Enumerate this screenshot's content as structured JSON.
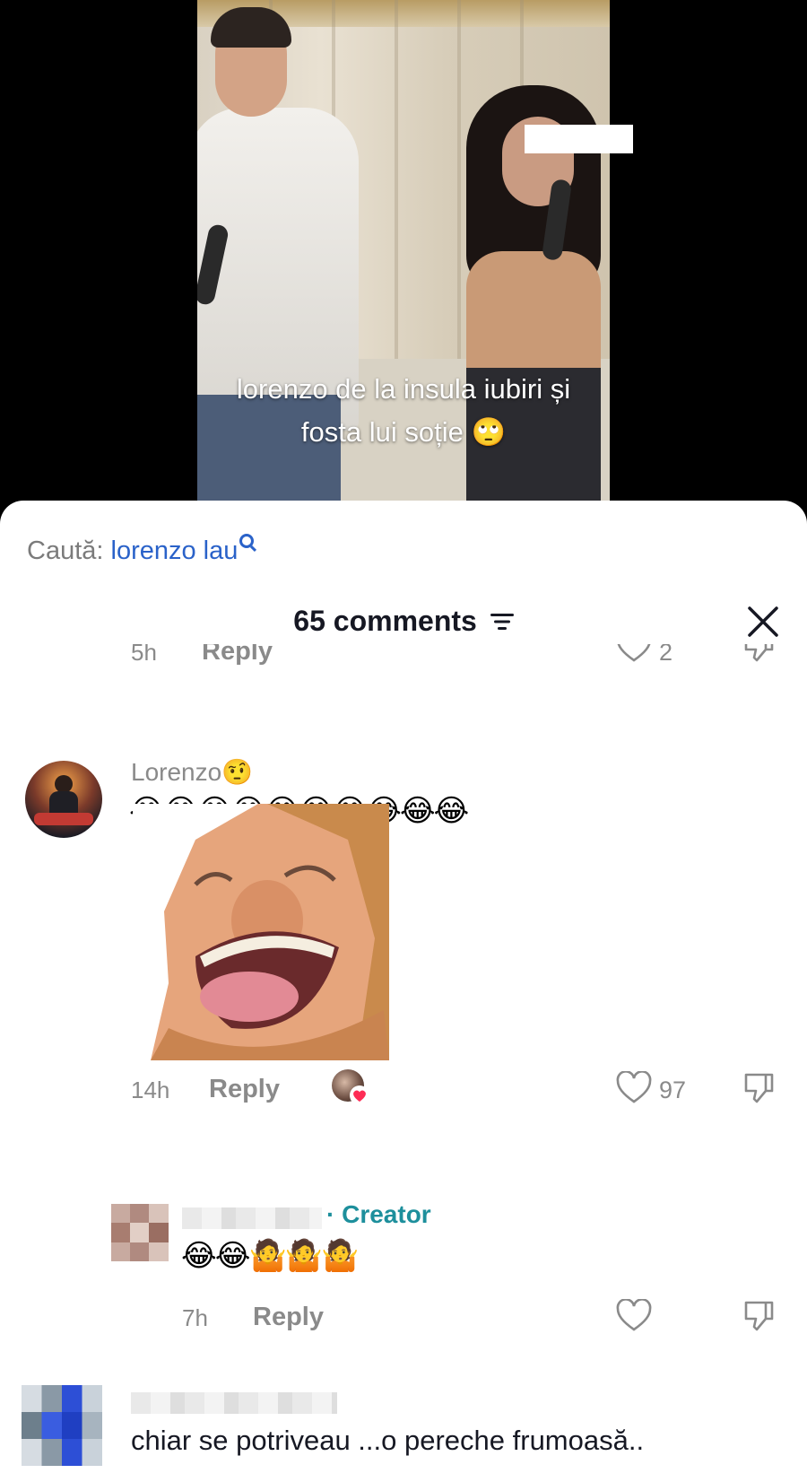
{
  "video": {
    "caption_line1": "lorenzo de la insula iubiri și",
    "caption_line2": "fosta lui soție 🙄"
  },
  "search": {
    "label": "Caută:",
    "keyword": "lorenzo lau"
  },
  "comments_header": {
    "title": "65 comments"
  },
  "partial_comment": {
    "time": "5h",
    "reply_label": "Reply",
    "like_count": "2"
  },
  "comment_lorenzo": {
    "username": "Lorenzo🤨",
    "emojis": "😂😂😂😂😂😂😂😂😂😂",
    "time": "14h",
    "reply_label": "Reply",
    "like_count": "97"
  },
  "reply_creator": {
    "creator_label": "· Creator",
    "emojis": "😂😂🤷🤷🤷",
    "time": "7h",
    "reply_label": "Reply"
  },
  "comment_bottom": {
    "text": "chiar se potriveau ...o pereche frumoasă.."
  },
  "colors": {
    "accent_blue": "#2a62c9",
    "creator_teal": "#1d8f9c",
    "like_red": "#fe2c55"
  }
}
